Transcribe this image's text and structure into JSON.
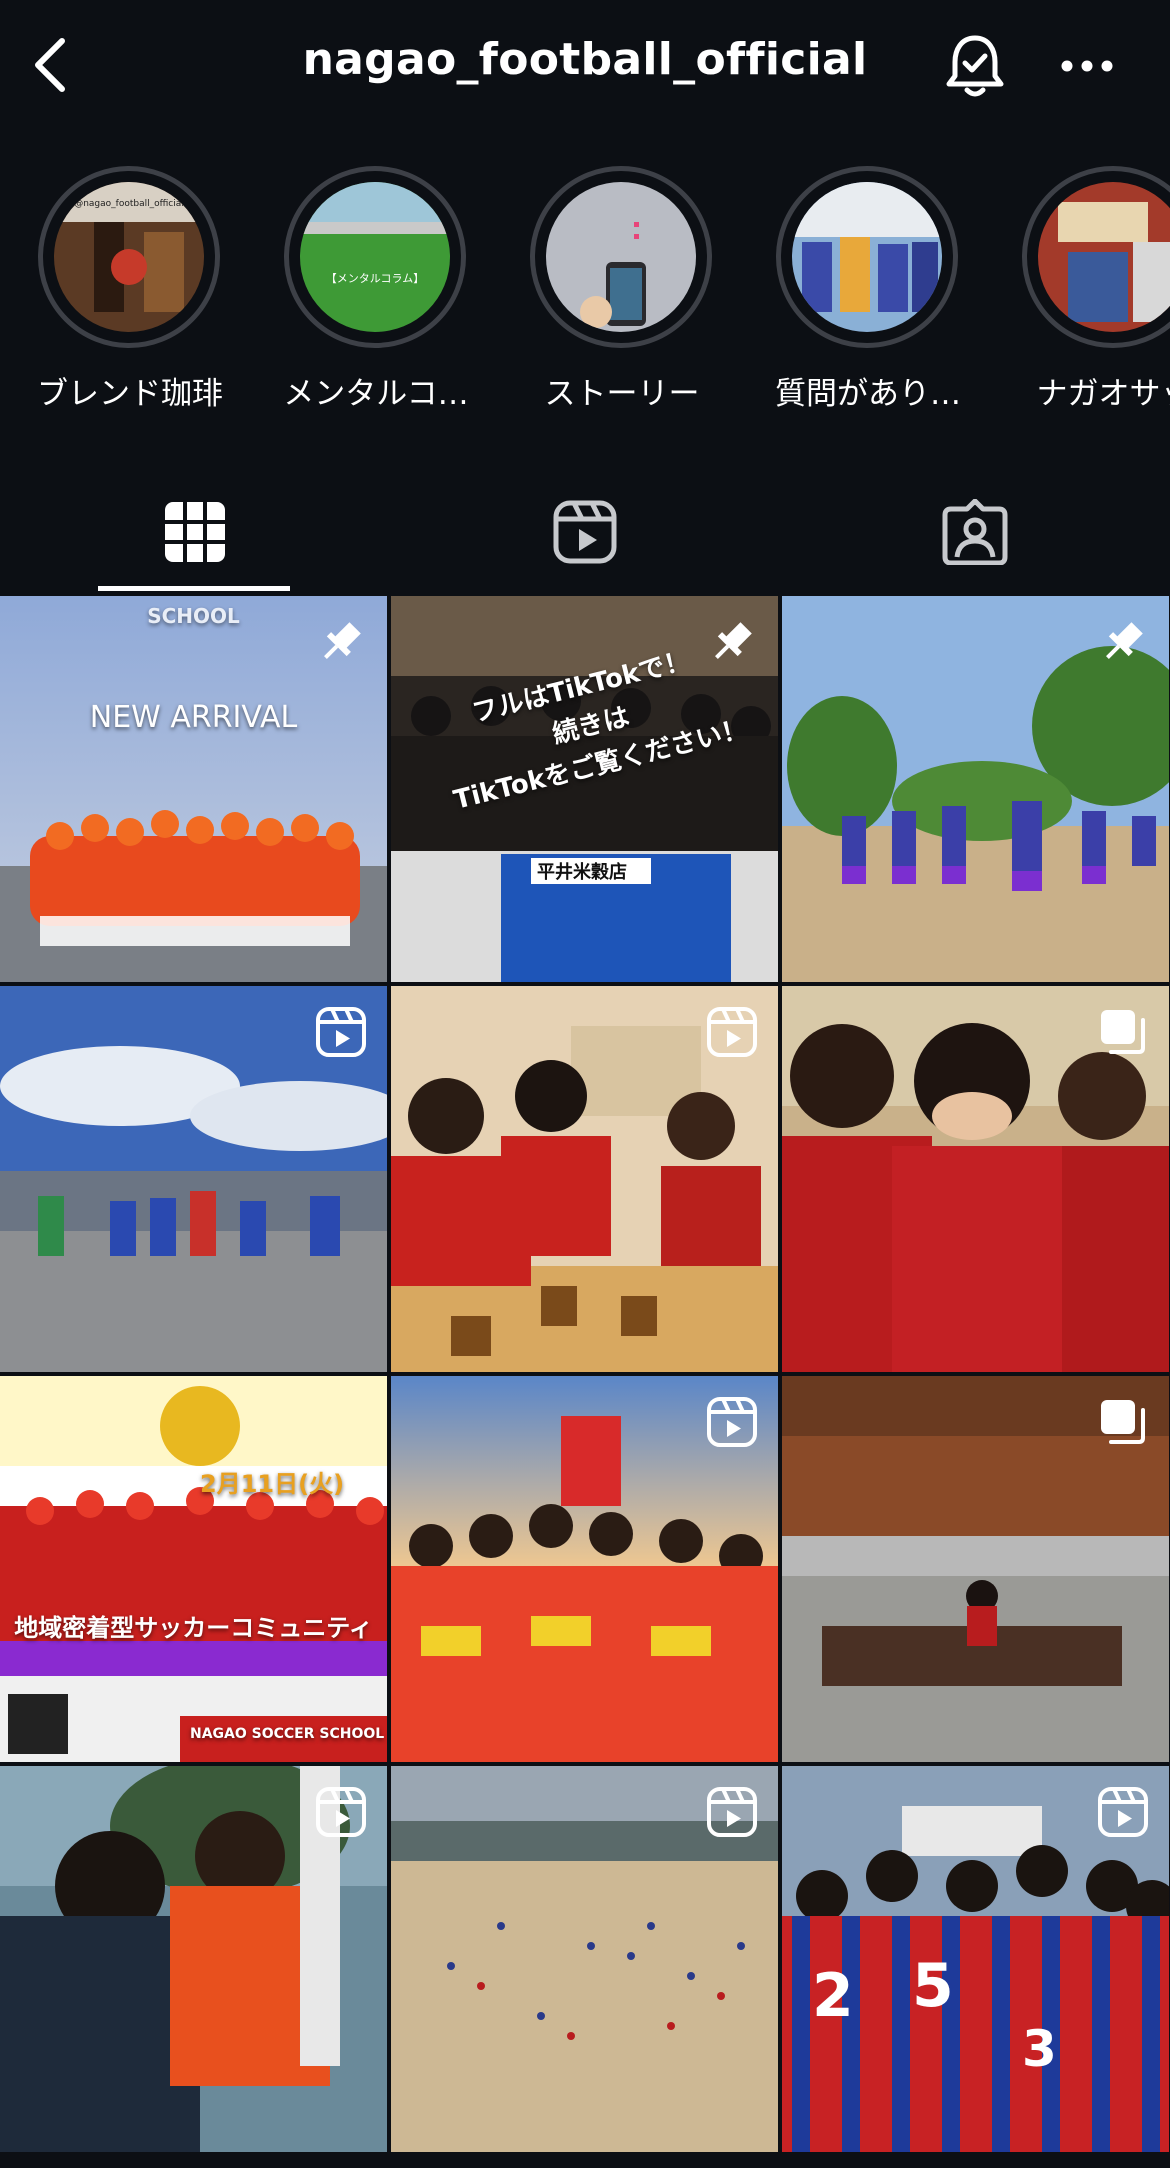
{
  "header": {
    "title": "nagao_football_official",
    "back_icon": "chevron-left-icon",
    "notify_icon": "bell-check-icon",
    "more_icon": "more-horizontal-icon"
  },
  "highlights": [
    {
      "label": "ブレンド珈琲",
      "thumb_text": "@nagao_football_official"
    },
    {
      "label": "メンタルコ…",
      "thumb_text": "【メンタルコラム】"
    },
    {
      "label": "ストーリー",
      "thumb_text": ""
    },
    {
      "label": "質問があり…",
      "thumb_text": ""
    },
    {
      "label": "ナガオサッ",
      "thumb_text": ""
    }
  ],
  "tabs": [
    {
      "name": "posts",
      "icon": "grid-icon",
      "active": true
    },
    {
      "name": "reels",
      "icon": "reels-icon",
      "active": false
    },
    {
      "name": "tagged",
      "icon": "tagged-person-icon",
      "active": false
    }
  ],
  "posts": [
    {
      "badge": "pin-icon",
      "overlay": "NEW ARRIVAL",
      "overlay_top": "SCHOOL"
    },
    {
      "badge": "pin-icon",
      "overlay": "フルはTikTokで！\n続きは\nTikTokをご覧ください！",
      "overlay_sub": "平井米穀店"
    },
    {
      "badge": "pin-icon",
      "overlay": ""
    },
    {
      "badge": "reels-icon",
      "overlay": ""
    },
    {
      "badge": "reels-icon",
      "overlay": ""
    },
    {
      "badge": "carousel-icon",
      "overlay": ""
    },
    {
      "badge": "none",
      "overlay": "地域密着型サッカーコミュニティ",
      "overlay_top": "2月11日(火)",
      "overlay_sub": "NAGAO SOCCER SCHOOL"
    },
    {
      "badge": "reels-icon",
      "overlay": ""
    },
    {
      "badge": "carousel-icon",
      "overlay": ""
    },
    {
      "badge": "reels-icon",
      "overlay": ""
    },
    {
      "badge": "reels-icon",
      "overlay": ""
    },
    {
      "badge": "reels-icon",
      "overlay": ""
    }
  ],
  "colors": {
    "background": "#0c0f14",
    "ring": "#3d4047",
    "text": "#ffffff"
  }
}
